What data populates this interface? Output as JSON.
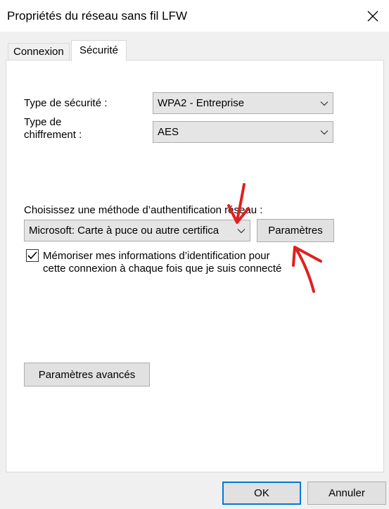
{
  "window": {
    "title": "Propriétés du réseau sans fil LFW"
  },
  "tabs": [
    {
      "label": "Connexion"
    },
    {
      "label": "Sécurité"
    }
  ],
  "security": {
    "type_label": "Type de sécurité :",
    "type_value": "WPA2 - Entreprise",
    "cipher_label_line1": "Type de",
    "cipher_label_line2": "chiffrement :",
    "cipher_value": "AES",
    "auth_method_label": "Choisissez une méthode d’authentification réseau :",
    "auth_method_value": "Microsoft: Carte à puce ou autre certifica",
    "settings_button": "Paramètres",
    "remember_line1": "Mémoriser mes informations d’identification pour",
    "remember_line2": "cette connexion à chaque fois que je suis connecté",
    "remember_checked": true,
    "advanced_button": "Paramètres avancés"
  },
  "footer": {
    "ok_button": "OK",
    "cancel_button": "Annuler"
  },
  "annotation_color": "#e0201f",
  "accent_color": "#0078d7"
}
